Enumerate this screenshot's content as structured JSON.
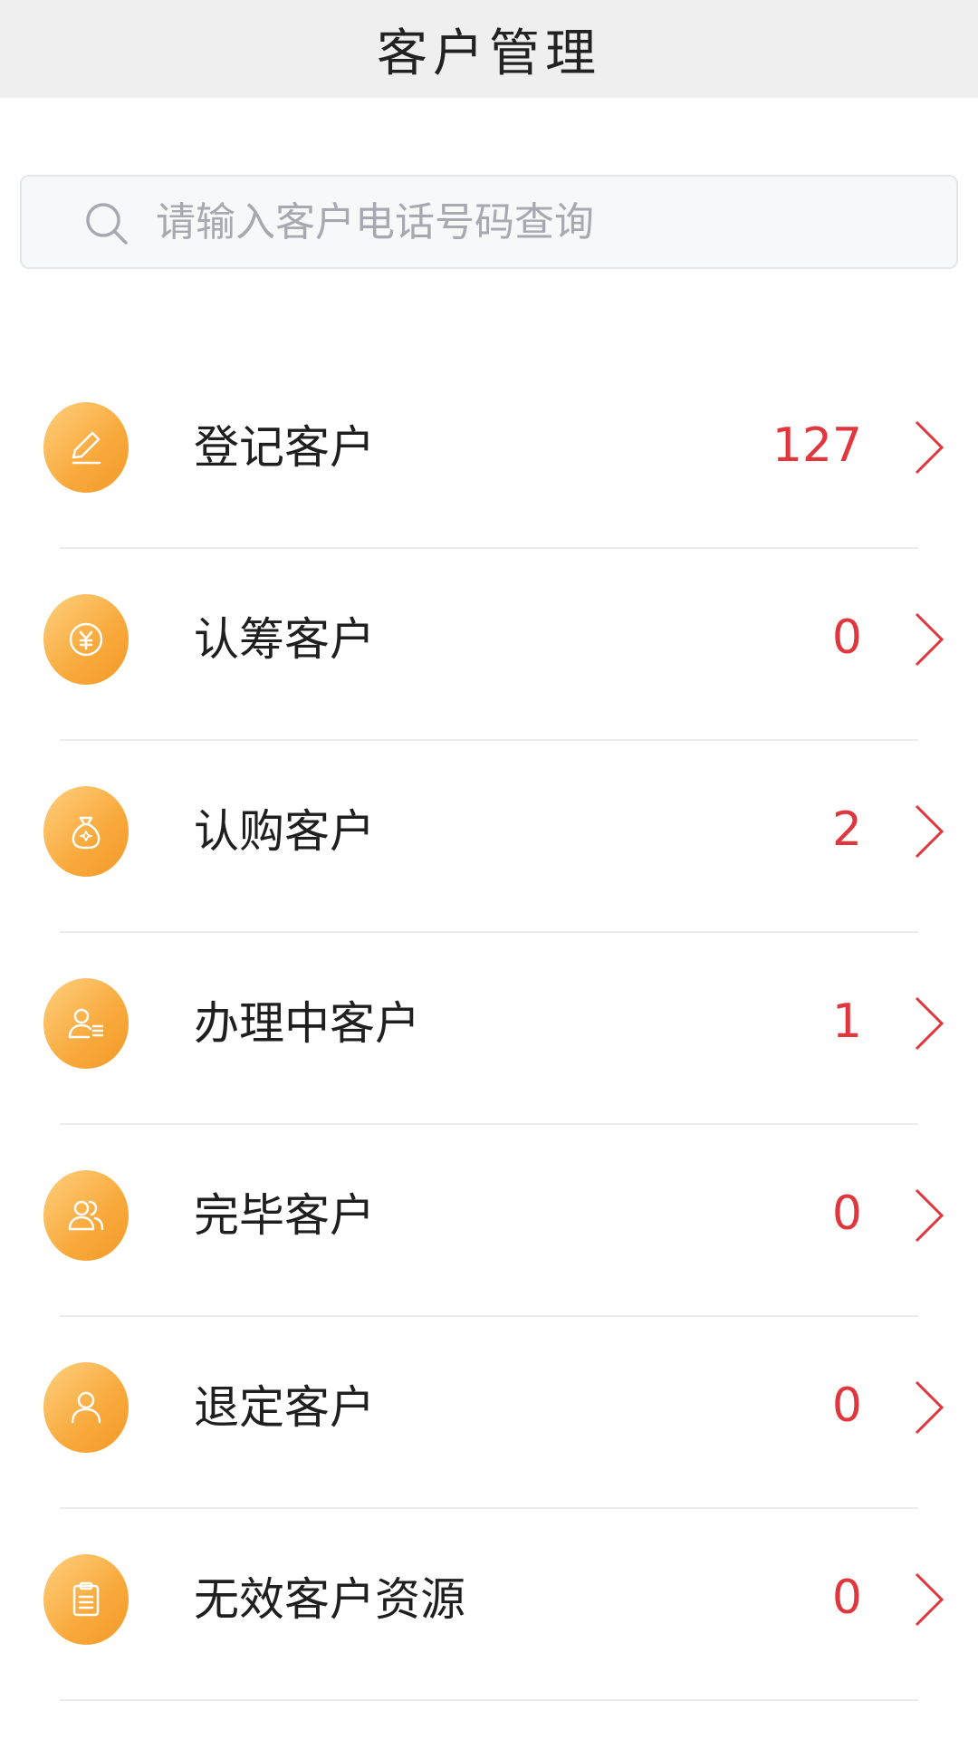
{
  "header": {
    "title": "客户管理"
  },
  "search": {
    "placeholder": "请输入客户电话号码查询",
    "value": ""
  },
  "colors": {
    "accent": "#f8a93b",
    "count": "#e2363d",
    "chevron": "#e2363d"
  },
  "list": {
    "items": [
      {
        "label": "登记客户",
        "count": "127",
        "icon": "edit-icon"
      },
      {
        "label": "认筹客户",
        "count": "0",
        "icon": "yuan-coin-icon"
      },
      {
        "label": "认购客户",
        "count": "2",
        "icon": "money-bag-icon"
      },
      {
        "label": "办理中客户",
        "count": "1",
        "icon": "user-list-icon"
      },
      {
        "label": "完毕客户",
        "count": "0",
        "icon": "users-icon"
      },
      {
        "label": "退定客户",
        "count": "0",
        "icon": "user-icon"
      },
      {
        "label": "无效客户资源",
        "count": "0",
        "icon": "clipboard-icon"
      }
    ]
  }
}
